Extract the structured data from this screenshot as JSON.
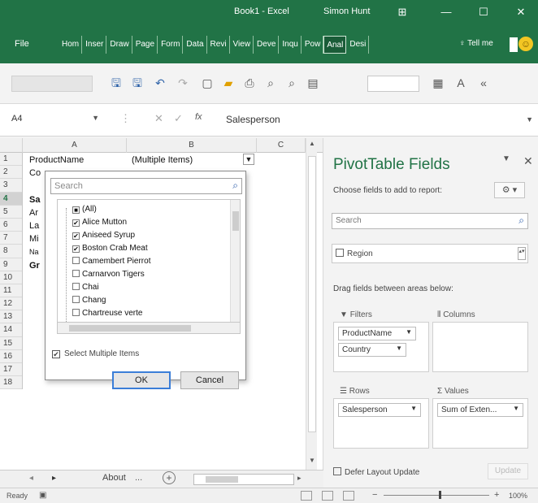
{
  "window": {
    "title": "Book1 - Excel",
    "user": "Simon Hunt",
    "controls": [
      "⊞",
      "—",
      "☐",
      "✕"
    ]
  },
  "ribbon": {
    "file_label": "File",
    "tabs": [
      "Hom",
      "Inser",
      "Draw",
      "Page",
      "Form",
      "Data",
      "Revi",
      "View",
      "Deve",
      "Inqu",
      "Pow",
      "Anal",
      "Desi"
    ],
    "active_tab": "Anal",
    "tell_me": "♀ Tell me"
  },
  "formula_bar": {
    "name_box": "A4",
    "fx_label": "fx",
    "content": "Salesperson"
  },
  "grid": {
    "columns": [
      "A",
      "B",
      "C"
    ],
    "rows": [
      "1",
      "2",
      "3",
      "4",
      "5",
      "6",
      "7",
      "8",
      "9",
      "10",
      "11",
      "12",
      "13",
      "14",
      "15",
      "16",
      "17",
      "18"
    ],
    "selected_row": "4",
    "a1": "ProductName",
    "b1": "(Multiple Items)",
    "a2": "Co",
    "a4": "Sa",
    "a5": "Ar",
    "a6": "La",
    "a7": "Mi",
    "a8": "Na",
    "a9": "Gr"
  },
  "filter_dropdown": {
    "search_placeholder": "Search",
    "items": [
      {
        "label": "(All)",
        "state": "■"
      },
      {
        "label": "Alice Mutton",
        "state": "✔"
      },
      {
        "label": "Aniseed Syrup",
        "state": "✔"
      },
      {
        "label": "Boston Crab Meat",
        "state": "✔"
      },
      {
        "label": "Camembert Pierrot",
        "state": ""
      },
      {
        "label": "Carnarvon Tigers",
        "state": ""
      },
      {
        "label": "Chai",
        "state": ""
      },
      {
        "label": "Chang",
        "state": ""
      },
      {
        "label": "Chartreuse verte",
        "state": ""
      }
    ],
    "select_multiple_label": "Select Multiple Items",
    "select_multiple_checked": "✔",
    "ok_label": "OK",
    "cancel_label": "Cancel"
  },
  "pivot_panel": {
    "title": "PivotTable Fields",
    "choose_label": "Choose fields to add to report:",
    "search_placeholder": "Search",
    "fields": [
      "Region"
    ],
    "drag_label": "Drag fields between areas below:",
    "filters_label": "Filters",
    "columns_label": "Columns",
    "rows_label": "Rows",
    "values_label": "Values",
    "filters": [
      "ProductName",
      "Country"
    ],
    "rows": [
      "Salesperson"
    ],
    "values": [
      "Sum of Exten..."
    ],
    "defer_label": "Defer Layout Update",
    "update_label": "Update"
  },
  "sheet_tabs": {
    "sheet_name": "About",
    "more": "...",
    "add": "+"
  },
  "status_bar": {
    "ready": "Ready",
    "zoom": "100%"
  },
  "colors": {
    "accent": "#217346",
    "ok_border": "#3b7ed8"
  }
}
